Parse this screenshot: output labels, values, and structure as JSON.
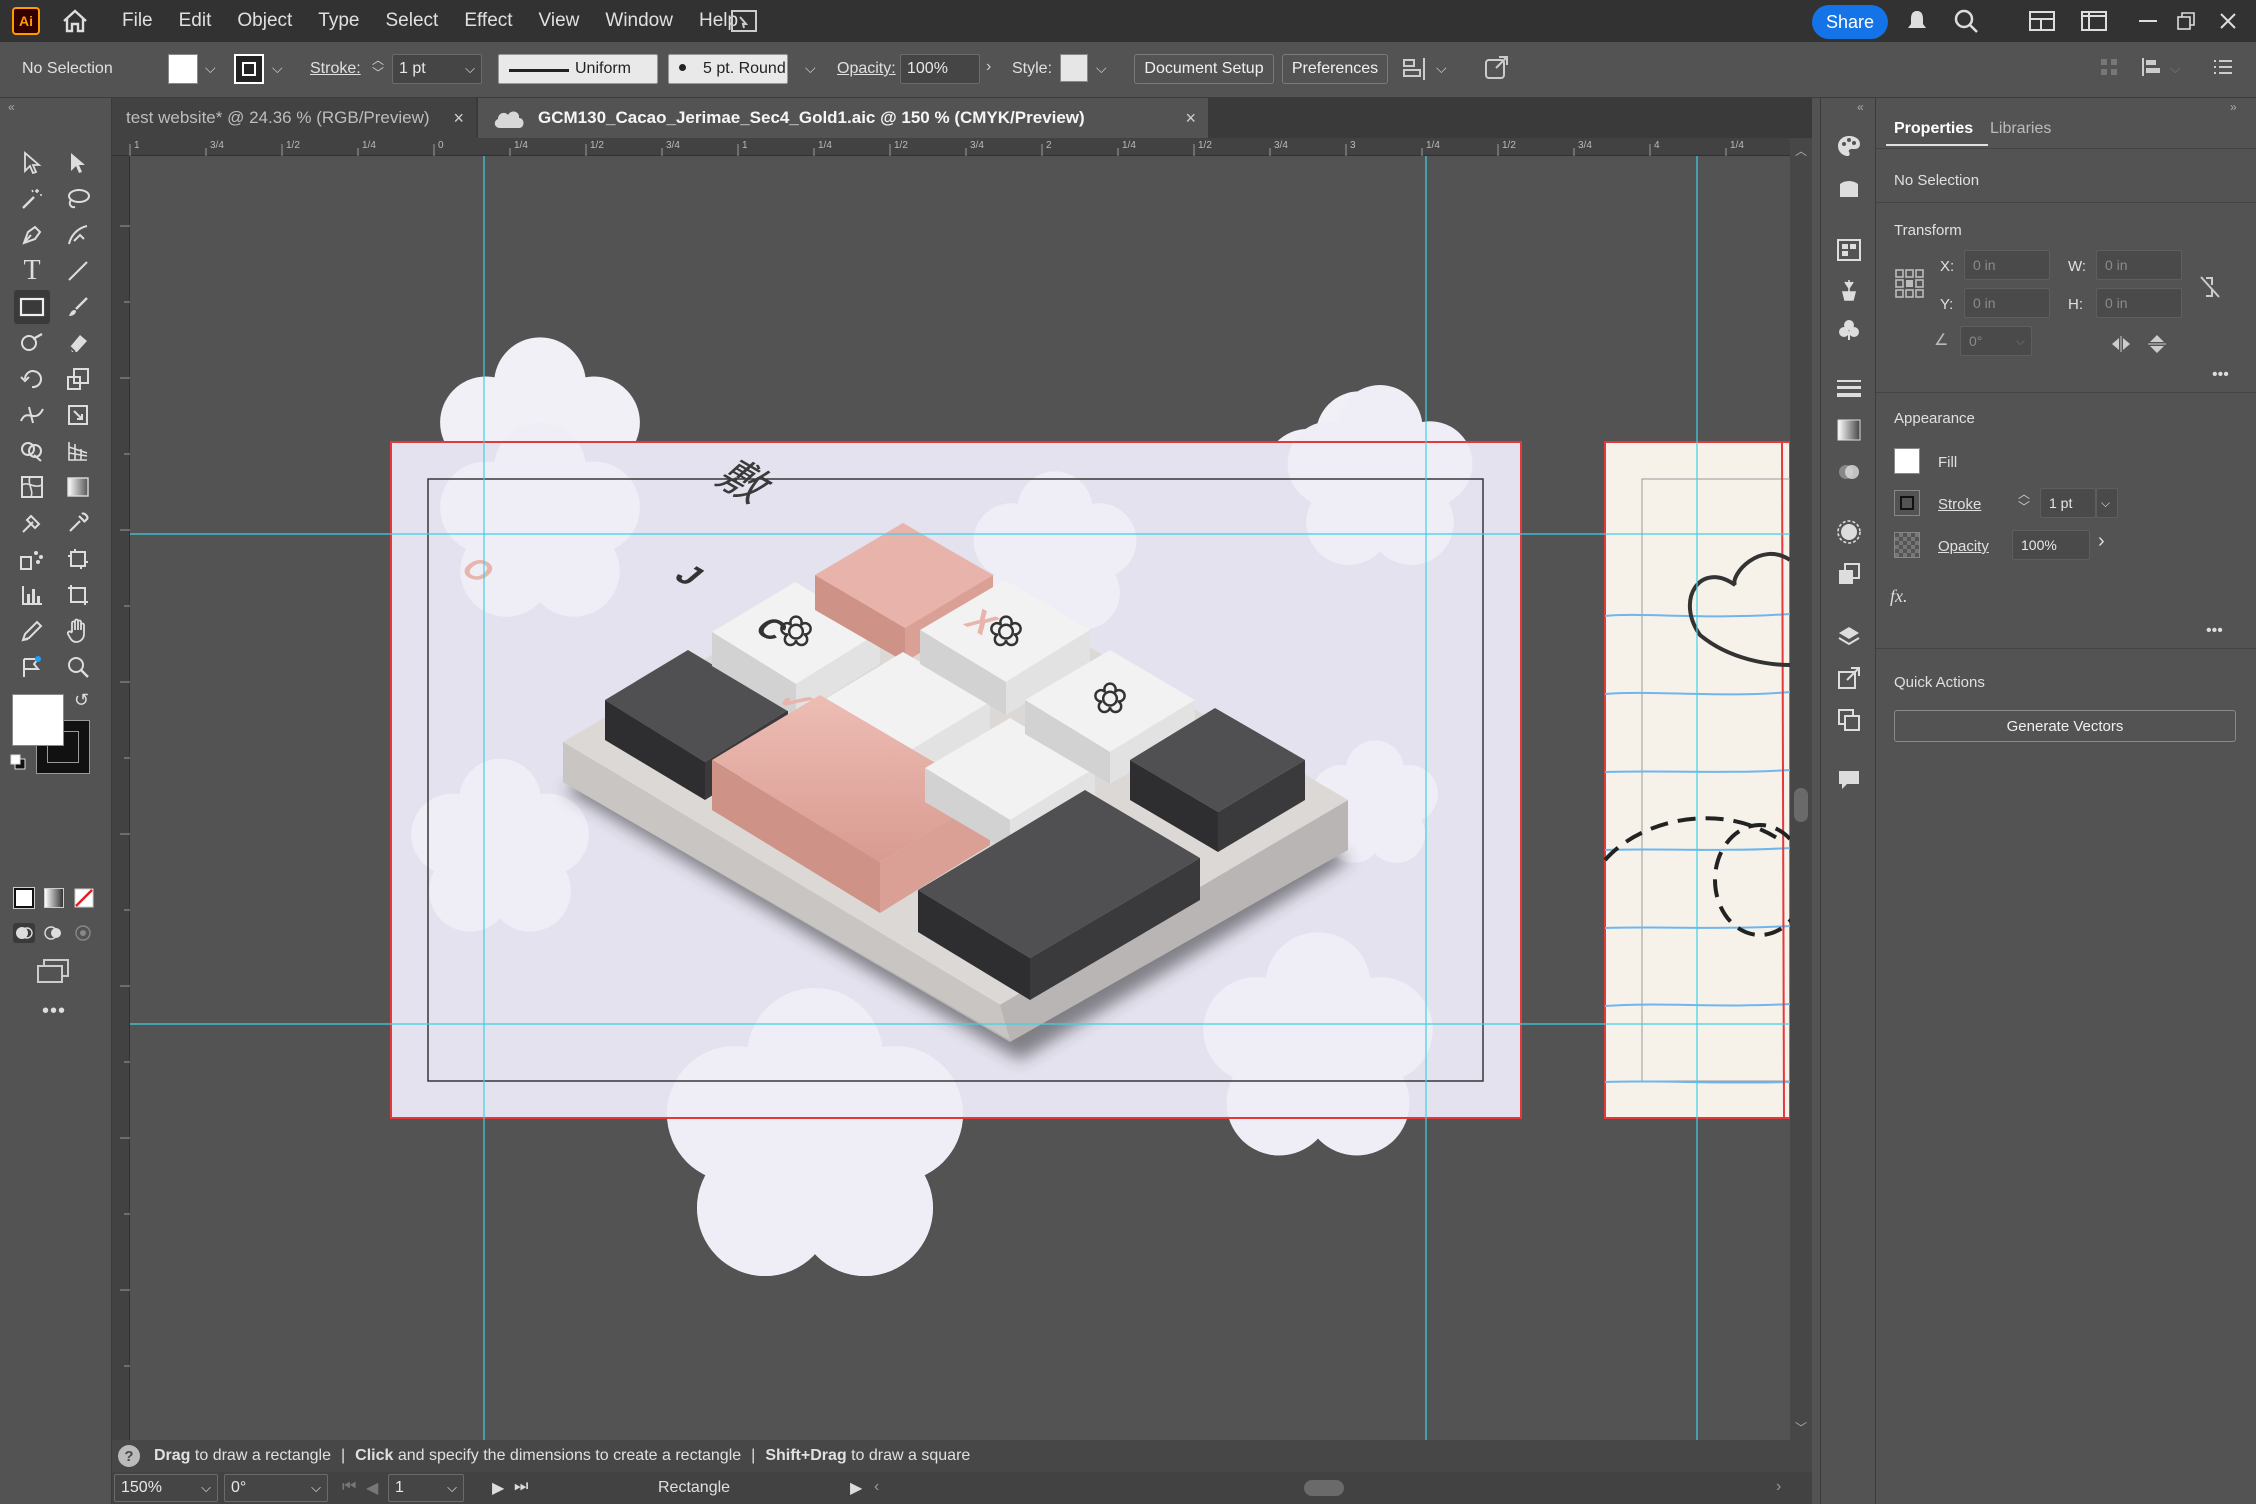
{
  "menubar": {
    "app_logo": "Ai",
    "items": [
      "File",
      "Edit",
      "Object",
      "Type",
      "Select",
      "Effect",
      "View",
      "Window",
      "Help"
    ],
    "share_label": "Share"
  },
  "control": {
    "selection": "No Selection",
    "stroke_label": "Stroke:",
    "stroke_value": "1 pt",
    "profile": "Uniform",
    "brush": "5 pt. Round",
    "opacity_label": "Opacity:",
    "opacity_value": "100%",
    "style_label": "Style:",
    "document_setup": "Document Setup",
    "preferences": "Preferences"
  },
  "tabs": [
    {
      "label": "test website* @ 24.36 % (RGB/Preview)",
      "close": "×"
    },
    {
      "label": "GCM130_Cacao_Jerimae_Sec4_Gold1.aic @ 150 % (CMYK/Preview)",
      "close": "×"
    }
  ],
  "artwork": {
    "key_labels": [
      "O",
      "J",
      "C",
      "X",
      "✓"
    ],
    "top_key_glyph": "敷",
    "colors": {
      "pink": "#e8b5ad",
      "dark": "#3f3f41",
      "white": "#f1f1f1",
      "lavender": "#e3e2ee",
      "cloud": "#efeef5",
      "paper": "#f6f2ea",
      "guide": "#3fd0e6",
      "artboard_border": "#e5383b"
    }
  },
  "status": {
    "hint_1_bold": "Drag",
    "hint_1": "to draw a rectangle",
    "hint_2_bold": "Click",
    "hint_2": "and specify the dimensions to create a rectangle",
    "hint_3_bold": "Shift+Drag",
    "hint_3": "to draw a square",
    "sep": "|"
  },
  "bottombar": {
    "zoom": "150%",
    "rotation": "0°",
    "artboard": "1",
    "tool_name": "Rectangle"
  },
  "properties": {
    "tab_properties": "Properties",
    "tab_libraries": "Libraries",
    "no_selection": "No Selection",
    "transform_title": "Transform",
    "x_label": "X:",
    "x_value": "0 in",
    "y_label": "Y:",
    "y_value": "0 in",
    "w_label": "W:",
    "w_value": "0 in",
    "h_label": "H:",
    "h_value": "0 in",
    "angle_value": "0°",
    "appearance_title": "Appearance",
    "fill_label": "Fill",
    "stroke_label": "Stroke",
    "stroke_value": "1 pt",
    "opacity_label": "Opacity",
    "opacity_value": "100%",
    "fx_label": "fx.",
    "more": "•••",
    "quick_actions_title": "Quick Actions",
    "generate_vectors": "Generate Vectors"
  }
}
